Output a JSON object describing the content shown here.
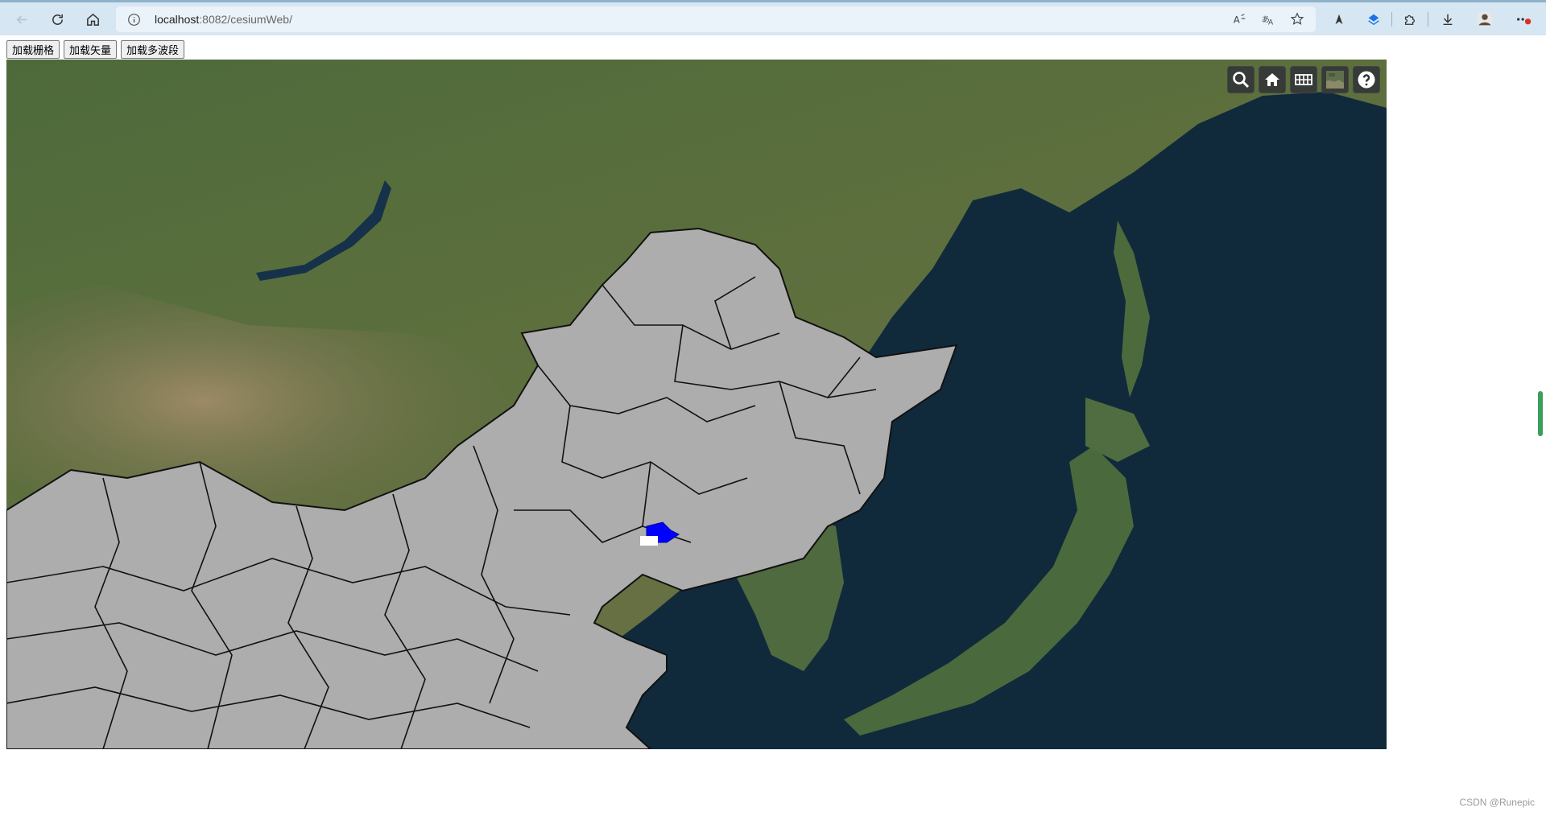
{
  "browser": {
    "url_host": "localhost",
    "url_rest": ":8082/cesiumWeb/",
    "icons": [
      "back-icon",
      "refresh-icon",
      "home-icon",
      "info-icon",
      "read-aloud-icon",
      "translate-icon",
      "favorites-icon",
      "extension-icon",
      "downloads-icon",
      "profile-icon",
      "more-icon"
    ]
  },
  "toolbar": {
    "load_raster": "加载栅格",
    "load_vector": "加载矢量",
    "load_multiband": "加载多波段"
  },
  "viewer": {
    "controls": [
      "search-icon",
      "home-view-icon",
      "scene-mode-icon",
      "base-layer-picker-icon",
      "help-icon"
    ],
    "overlay_fill": "#adadad",
    "highlight_fill": "#0000ff"
  },
  "watermark": "CSDN @Runepic"
}
